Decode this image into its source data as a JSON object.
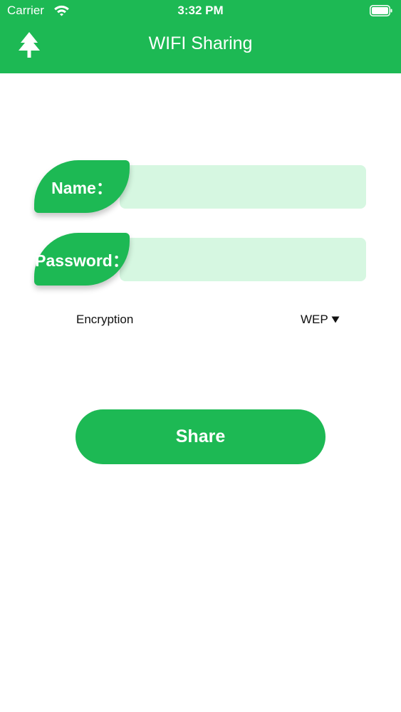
{
  "status_bar": {
    "carrier": "Carrier",
    "time": "3:32 PM",
    "wifi_icon": "wifi-icon",
    "battery_icon": "battery-icon"
  },
  "header": {
    "title": "WIFI Sharing",
    "left_icon": "tree-icon"
  },
  "form": {
    "name_label": "Name：",
    "name_value": "",
    "password_label": "Password：",
    "password_value": "",
    "encryption_label": "Encryption",
    "encryption_value": "WEP",
    "dropdown_icon": "dropdown-arrow-icon"
  },
  "actions": {
    "share_label": "Share"
  },
  "colors": {
    "primary": "#1db954",
    "field_background": "#d6f7e1",
    "background": "#ffffff",
    "text": "#111111"
  }
}
